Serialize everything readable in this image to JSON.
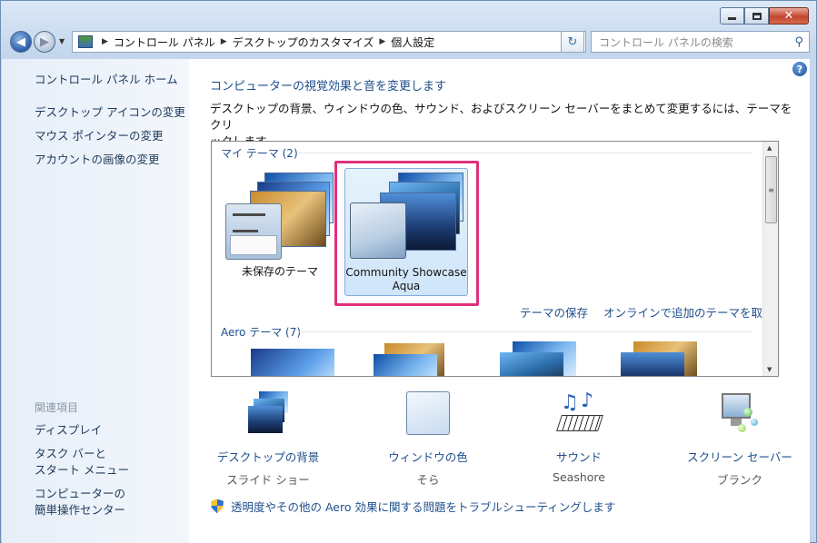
{
  "window": {
    "min_glyph": "─",
    "max_glyph": "□",
    "close_glyph": "✕"
  },
  "nav": {
    "back_glyph": "◀",
    "fwd_glyph": "▶",
    "breadcrumbs": [
      "コントロール パネル",
      "デスクトップのカスタマイズ",
      "個人設定"
    ],
    "search_placeholder": "コントロール パネルの検索",
    "search_glyph": "⚲",
    "refresh_glyph": "↻"
  },
  "sidebar": {
    "home": "コントロール パネル ホーム",
    "links": [
      "デスクトップ アイコンの変更",
      "マウス ポインターの変更",
      "アカウントの画像の変更"
    ],
    "related_heading": "関連項目",
    "related": [
      [
        "ディスプレイ"
      ],
      [
        "タスク バーと",
        "スタート メニュー"
      ],
      [
        "コンピューターの",
        "簡単操作センター"
      ]
    ]
  },
  "main": {
    "help_glyph": "?",
    "title": "コンピューターの視覚効果と音を変更します",
    "description_line1": "デスクトップの背景、ウィンドウの色、サウンド、およびスクリーン セーバーをまとめて変更するには、テーマをクリ",
    "description_line2": "ックします。",
    "my_themes_heading": "マイ テーマ (2)",
    "themes": [
      {
        "label": "未保存のテーマ",
        "selected": false
      },
      {
        "label_line1": "Community Showcase",
        "label_line2": "Aqua",
        "selected": true
      }
    ],
    "save_theme_link": "テーマの保存",
    "get_more_link": "オンラインで追加のテーマを取得",
    "aero_heading": "Aero テーマ (7)",
    "settings": [
      {
        "label": "デスクトップの背景",
        "value": "スライド ショー",
        "icon": "desktop-background-icon"
      },
      {
        "label": "ウィンドウの色",
        "value": "そら",
        "icon": "window-color-icon"
      },
      {
        "label": "サウンド",
        "value": "Seashore",
        "icon": "sound-icon"
      },
      {
        "label": "スクリーン セーバー",
        "value": "ブランク",
        "icon": "screensaver-icon"
      }
    ],
    "troubleshoot_link": "透明度やその他の Aero 効果に関する問題をトラブルシューティングします"
  },
  "colors": {
    "link": "#1e4e8c",
    "selection_highlight": "#e0307a",
    "selected_tile": "#cfe5fa"
  }
}
